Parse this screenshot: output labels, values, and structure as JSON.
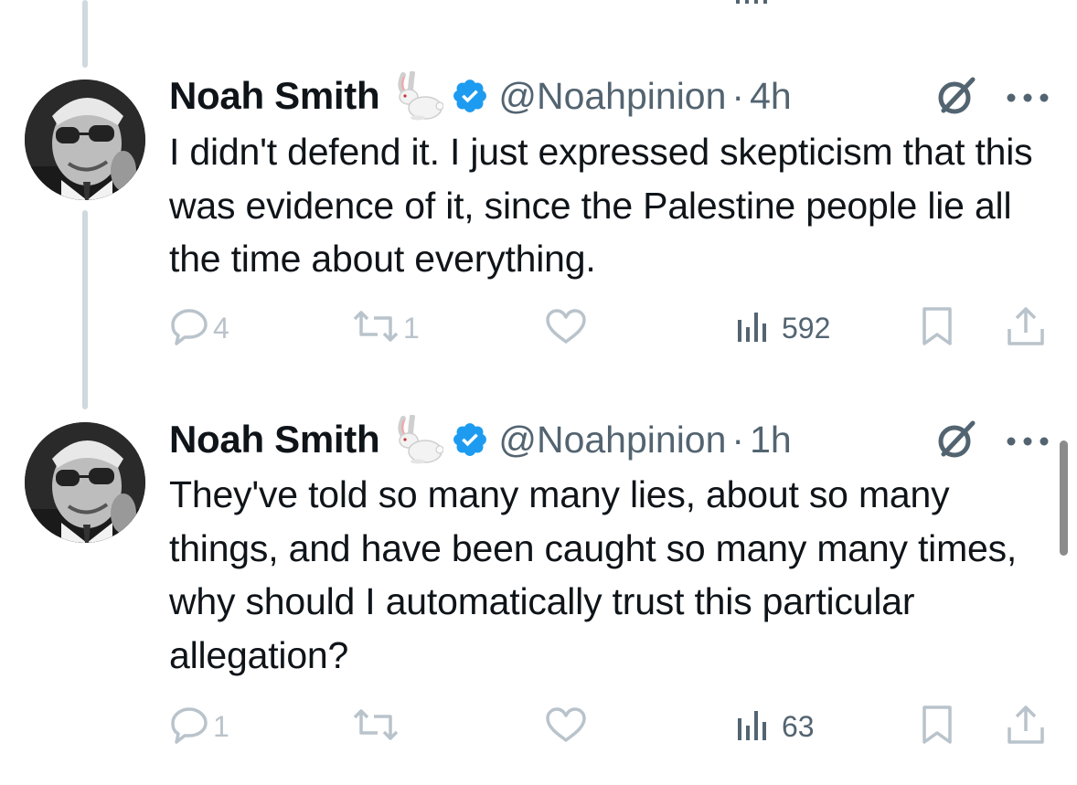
{
  "tweets": [
    {
      "author_name": "Noah Smith",
      "handle": "@Noahpinion",
      "separator": "·",
      "time": "4h",
      "text": "I didn't defend it. I just expressed skepticism that this was evidence of it, since the Palestine people lie all the time about everything.",
      "replies": "4",
      "reposts": "1",
      "likes": "",
      "views": "592"
    },
    {
      "author_name": "Noah Smith",
      "handle": "@Noahpinion",
      "separator": "·",
      "time": "1h",
      "text": "They've told so many many lies, about so many things, and have been caught so many many times, why should I automatically trust this particular allegation?",
      "replies": "1",
      "reposts": "",
      "likes": "",
      "views": "63"
    }
  ],
  "icons": {
    "name_emoji": "rabbit-emoji",
    "badge": "verified-badge-icon",
    "grok": "grok-icon",
    "more": "more-options-icon",
    "reply": "reply-icon",
    "repost": "repost-icon",
    "like": "like-icon",
    "views": "views-icon",
    "bookmark": "bookmark-icon",
    "share": "share-icon"
  },
  "colors": {
    "text": "#0f1419",
    "secondary": "#536471",
    "verified": "#1d9bf0",
    "muted_icon": "#b9c3cb",
    "thread_line": "#cfd9de"
  }
}
